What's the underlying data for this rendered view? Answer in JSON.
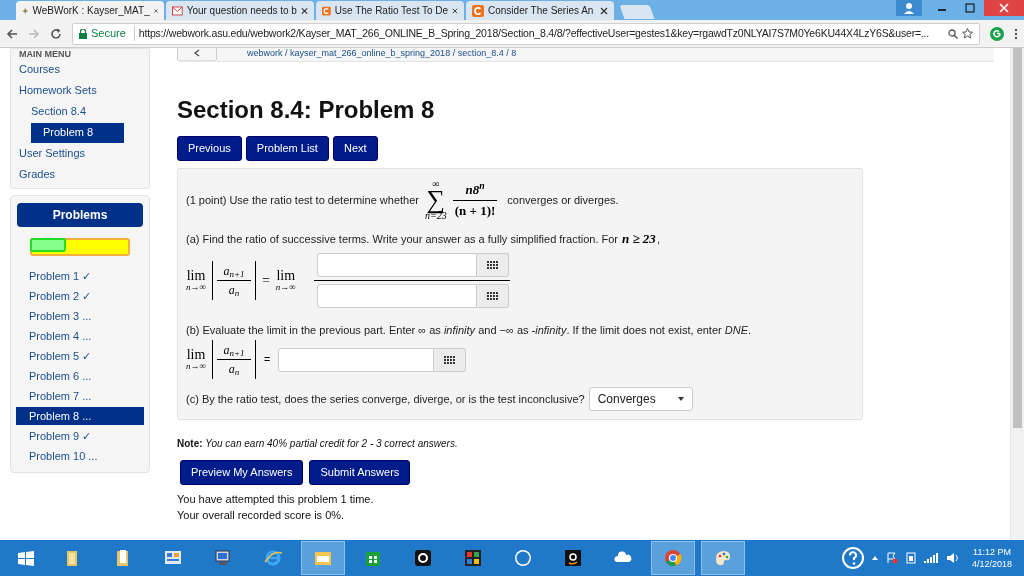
{
  "browser": {
    "tabs": [
      {
        "title": "WeBWorK : Kayser_MAT_",
        "kind": "star",
        "selected": true
      },
      {
        "title": "Your question needs to b",
        "kind": "mail",
        "selected": false
      },
      {
        "title": "Use The Ratio Test To De",
        "kind": "letter",
        "selected": false
      },
      {
        "title": "Consider The Series An",
        "kind": "letter",
        "selected": false
      }
    ],
    "secure_label": "Secure",
    "url": "https://webwork.asu.edu/webwork2/Kayser_MAT_266_ONLINE_B_Spring_2018/Section_8.4/8/?effectiveUser=gestes1&key=rgawdTz0NLYAI7S7M0Ye6KU44X4LzY6S&user=..."
  },
  "main_menu": {
    "title": "MAIN MENU",
    "items": [
      {
        "label": "Courses",
        "selected": false
      },
      {
        "label": "Homework Sets",
        "selected": false,
        "children": [
          {
            "label": "Section 8.4",
            "selected": false,
            "children": [
              {
                "label": "Problem 8",
                "selected": true
              }
            ]
          }
        ]
      },
      {
        "label": "User Settings",
        "selected": false
      },
      {
        "label": "Grades",
        "selected": false
      }
    ]
  },
  "problems_panel": {
    "title": "Problems",
    "level": 0.38,
    "items": [
      {
        "label": "Problem 1",
        "status": "✓",
        "selected": false
      },
      {
        "label": "Problem 2",
        "status": "✓",
        "selected": false
      },
      {
        "label": "Problem 3",
        "status": "...",
        "selected": false
      },
      {
        "label": "Problem 4",
        "status": "...",
        "selected": false
      },
      {
        "label": "Problem 5",
        "status": "✓",
        "selected": false
      },
      {
        "label": "Problem 6",
        "status": "...",
        "selected": false
      },
      {
        "label": "Problem 7",
        "status": "...",
        "selected": false
      },
      {
        "label": "Problem 8",
        "status": "...",
        "selected": true
      },
      {
        "label": "Problem 9",
        "status": "✓",
        "selected": false
      },
      {
        "label": "Problem 10",
        "status": "...",
        "selected": false
      }
    ]
  },
  "breadcrumb": "webwork / kayser_mat_266_online_b_spring_2018 / section_8.4 / 8",
  "title": "Section 8.4: Problem 8",
  "nav_buttons": [
    "Previous",
    "Problem List",
    "Next"
  ],
  "problem": {
    "intro": "(1 point) Use the ratio test to determine whether",
    "series": {
      "symbol": "∑",
      "upper": "∞",
      "lower": "n=23",
      "numerator": "n8$^{n}$",
      "denominator": "(n + 1)!"
    },
    "intro_end": "converges or diverges.",
    "part_a": {
      "text": "(a) Find the ratio of successive terms. Write your answer as a fully simplified fraction. For",
      "condition": "n ≥ 23",
      "condition_end": ",",
      "lim": {
        "lim": "lim",
        "sub": "n→∞",
        "num": "a$_{n+1}$",
        "den": "a$_{n}$"
      },
      "equals": "=",
      "lim2": {
        "lim": "lim",
        "sub": "n→∞"
      }
    },
    "part_b": {
      "text": "(b) Evaluate the limit in the previous part. Enter ∞ as *infinity* and −∞ as *-infinity*. If the limit does not exist, enter *DNE*.",
      "lim": {
        "lim": "lim",
        "sub": "n→∞",
        "num": "a$_{n+1}$",
        "den": "a$_{n}$"
      },
      "equals": "="
    },
    "part_c": {
      "text": "(c) By the ratio test, does the series converge, diverge, or is the test inconclusive?",
      "answer": "Converges"
    }
  },
  "note": "**Note:** *You can earn 40% partial credit for 2 - 3 correct answers.*",
  "answer_buttons": [
    "Preview My Answers",
    "Submit Answers"
  ],
  "attempts": [
    "You have attempted this problem 1 time.",
    "Your overall recorded score is 0%."
  ],
  "taskbar": {
    "apps": [
      {
        "active": false
      },
      {
        "active": false
      },
      {
        "active": false
      },
      {
        "active": false
      },
      {
        "active": false
      },
      {
        "active": true
      },
      {
        "active": false
      },
      {
        "active": false
      },
      {
        "active": false
      },
      {
        "active": false
      },
      {
        "active": false
      },
      {
        "active": false
      },
      {
        "active": true
      },
      {
        "active": true
      }
    ],
    "time": "11:12 PM",
    "date": "4/12/2018"
  }
}
